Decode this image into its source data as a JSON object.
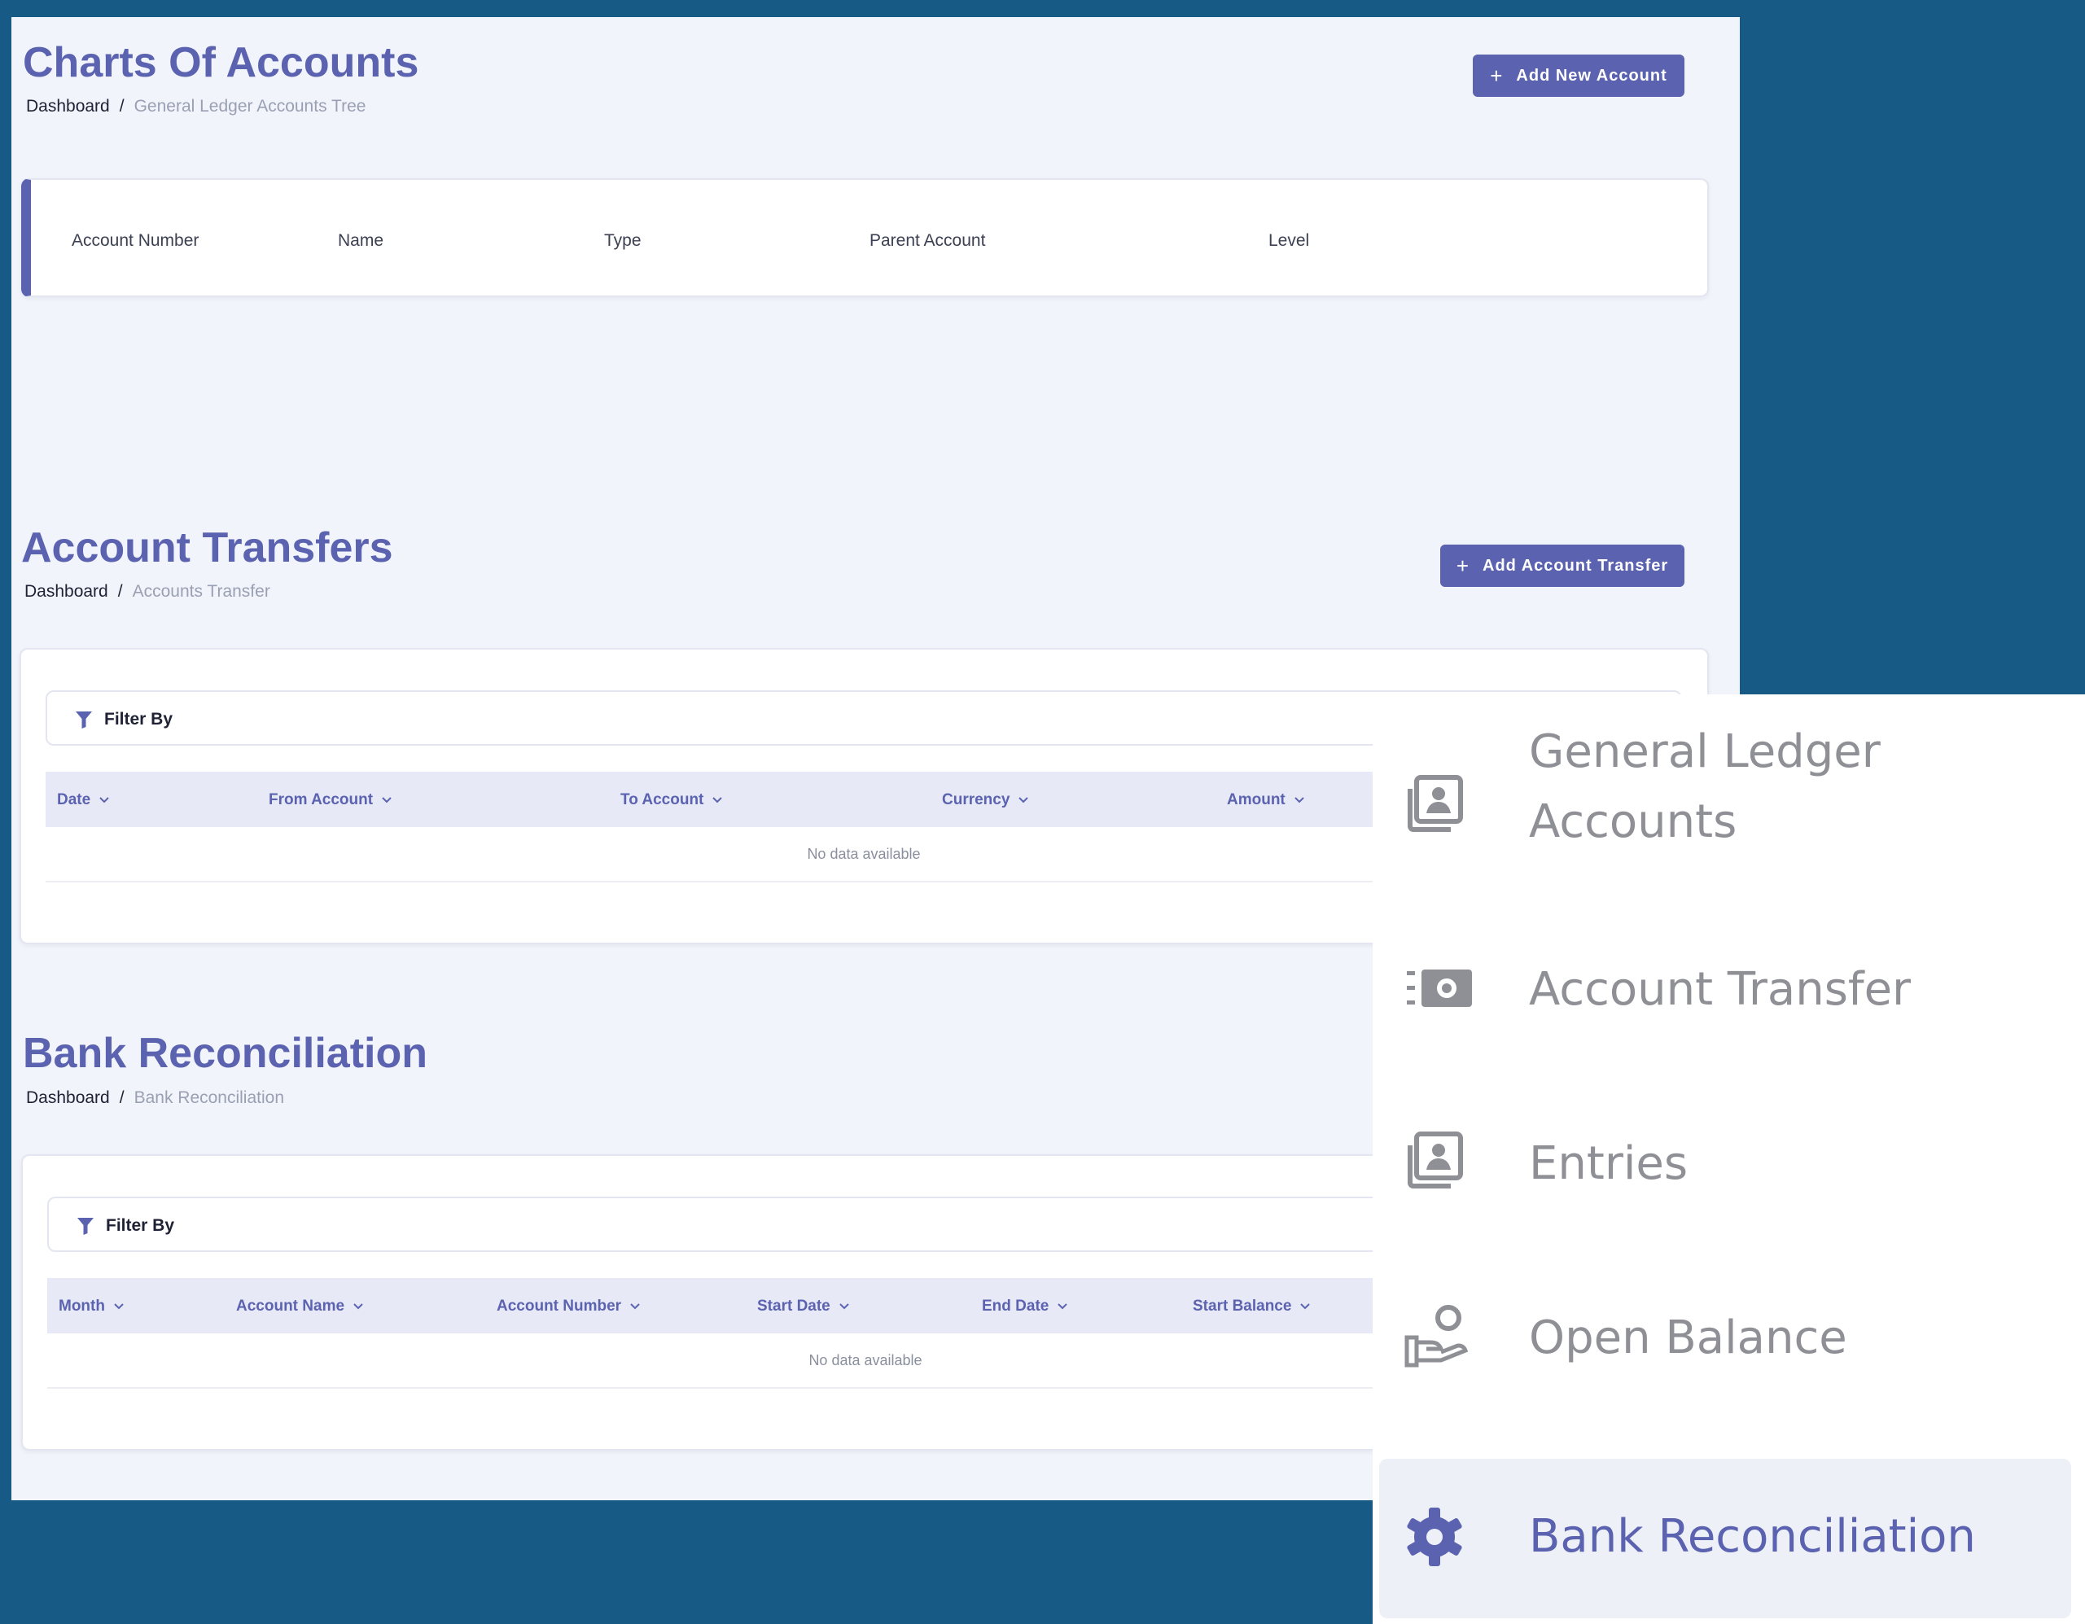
{
  "charts": {
    "title": "Charts Of Accounts",
    "breadcrumb_root": "Dashboard",
    "breadcrumb_sep": "/",
    "breadcrumb_current": "General Ledger Accounts Tree",
    "add_button": "Add New Account",
    "columns": [
      "Account Number",
      "Name",
      "Type",
      "Parent Account",
      "Level"
    ]
  },
  "transfers": {
    "title": "Account Transfers",
    "breadcrumb_root": "Dashboard",
    "breadcrumb_sep": "/",
    "breadcrumb_current": "Accounts Transfer",
    "add_button": "Add Account Transfer",
    "filter_label": "Filter By",
    "columns": [
      "Date",
      "From Account",
      "To Account",
      "Currency",
      "Amount"
    ],
    "empty_text": "No data available"
  },
  "reconciliation": {
    "title": "Bank Reconciliation",
    "breadcrumb_root": "Dashboard",
    "breadcrumb_sep": "/",
    "breadcrumb_current": "Bank Reconciliation",
    "filter_label": "Filter By",
    "columns": [
      "Month",
      "Account Name",
      "Account Number",
      "Start Date",
      "End Date",
      "Start Balance"
    ],
    "empty_text": "No data available"
  },
  "sidebar": {
    "items": [
      {
        "label_line1": "General Ledger",
        "label_line2": "Accounts",
        "icon": "ledger-icon",
        "active": false
      },
      {
        "label": "Account Transfer",
        "icon": "money-transfer-icon",
        "active": false
      },
      {
        "label": "Entries",
        "icon": "entries-icon",
        "active": false
      },
      {
        "label": "Open Balance",
        "icon": "hand-coin-icon",
        "active": false
      },
      {
        "label": "Bank Reconciliation",
        "icon": "gear-icon",
        "active": true
      }
    ]
  },
  "colors": {
    "accent": "#5b63b0",
    "background": "#165a85",
    "panel": "#f2f4fb",
    "table_header": "#e7e9f6",
    "sidebar_text": "#8f8f96"
  }
}
